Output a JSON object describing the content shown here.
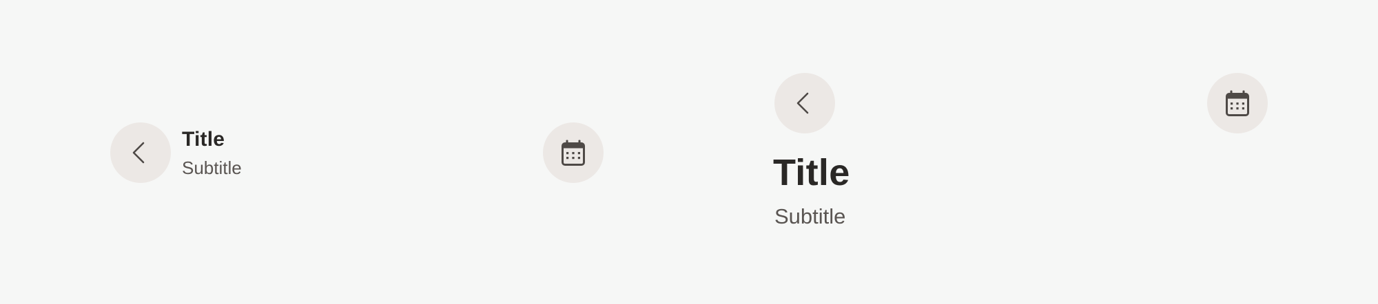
{
  "compact_header": {
    "title": "Title",
    "subtitle": "Subtitle",
    "back_icon": "chevron-left-icon",
    "action_icon": "calendar-icon"
  },
  "large_header": {
    "title": "Title",
    "subtitle": "Subtitle",
    "back_icon": "chevron-left-icon",
    "action_icon": "calendar-icon"
  },
  "colors": {
    "background": "#f6f7f6",
    "button_background": "#ece8e5",
    "icon": "#4e4946",
    "title": "#2a2826",
    "subtitle": "#5a5552"
  }
}
